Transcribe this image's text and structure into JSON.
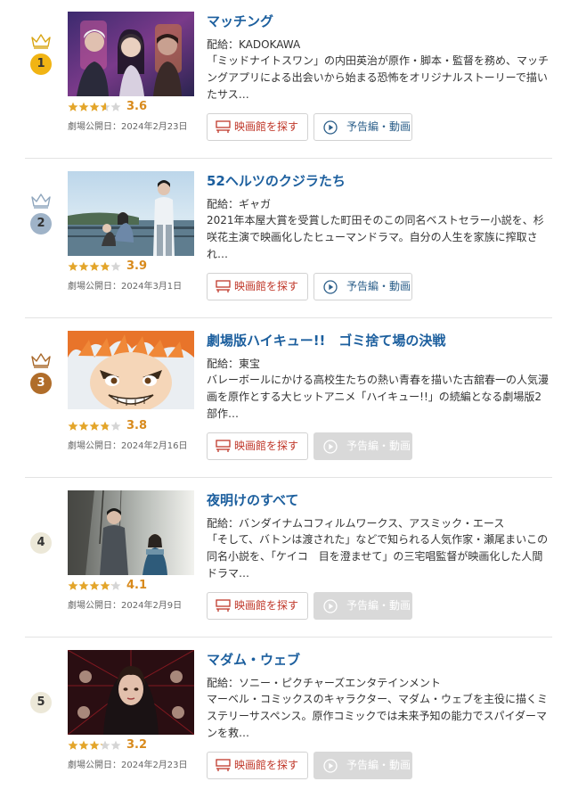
{
  "labels": {
    "find_theater": "映画館を探す",
    "trailer": "予告編・動画"
  },
  "colors": {
    "gold": "#f1b414",
    "silver": "#9fb3c8",
    "bronze": "#b06d2a",
    "plain_rank_bg": "#ece8d8",
    "title_blue": "#1c5f9e",
    "star": "#e3a52a",
    "theater_red": "#c0392b",
    "disabled_gray": "#d9d9d9"
  },
  "movies": [
    {
      "rank": "1",
      "rank_style": "gold",
      "crown": true,
      "title": "マッチング",
      "distributor": "配給：KADOKAWA",
      "description": "「ミッドナイトスワン」の内田英治が原作・脚本・監督を務め、マッチングアプリによる出会いから始まる恐怖をオリジナルストーリーで描いたサス…",
      "rating": 3.6,
      "rating_text": "3.6",
      "release": "劇場公開日：2024年2月23日",
      "trailer_enabled": true,
      "poster": "poster-matching"
    },
    {
      "rank": "2",
      "rank_style": "silver",
      "crown": true,
      "title": "52ヘルツのクジラたち",
      "distributor": "配給：ギャガ",
      "description": "2021年本屋大賞を受賞した町田そのこの同名ベストセラー小説を、杉咲花主演で映画化したヒューマンドラマ。自分の人生を家族に搾取され…",
      "rating": 3.9,
      "rating_text": "3.9",
      "release": "劇場公開日：2024年3月1日",
      "trailer_enabled": true,
      "poster": "poster-52hz"
    },
    {
      "rank": "3",
      "rank_style": "bronze",
      "crown": true,
      "title": "劇場版ハイキュー!!　ゴミ捨て場の決戦",
      "distributor": "配給：東宝",
      "description": "バレーボールにかける高校生たちの熱い青春を描いた古舘春一の人気漫画を原作とする大ヒットアニメ「ハイキュー!!」の続編となる劇場版2部作…",
      "rating": 3.8,
      "rating_text": "3.8",
      "release": "劇場公開日：2024年2月16日",
      "trailer_enabled": false,
      "poster": "poster-haikyu"
    },
    {
      "rank": "4",
      "rank_style": "plain",
      "crown": false,
      "title": "夜明けのすべて",
      "distributor": "配給：バンダイナムコフィルムワークス、アスミック・エース",
      "description": "「そして、バトンは渡された」などで知られる人気作家・瀬尾まいこの同名小説を、「ケイコ　目を澄ませて」の三宅唱監督が映画化した人間ドラマ…",
      "rating": 4.1,
      "rating_text": "4.1",
      "release": "劇場公開日：2024年2月9日",
      "trailer_enabled": false,
      "poster": "poster-yoake"
    },
    {
      "rank": "5",
      "rank_style": "plain",
      "crown": false,
      "title": "マダム・ウェブ",
      "distributor": "配給：ソニー・ピクチャーズエンタテインメント",
      "description": "マーベル・コミックスのキャラクター、マダム・ウェブを主役に描くミステリーサスペンス。原作コミックでは未来予知の能力でスパイダーマンを救…",
      "rating": 3.2,
      "rating_text": "3.2",
      "release": "劇場公開日：2024年2月23日",
      "trailer_enabled": false,
      "poster": "poster-madame-web"
    }
  ]
}
